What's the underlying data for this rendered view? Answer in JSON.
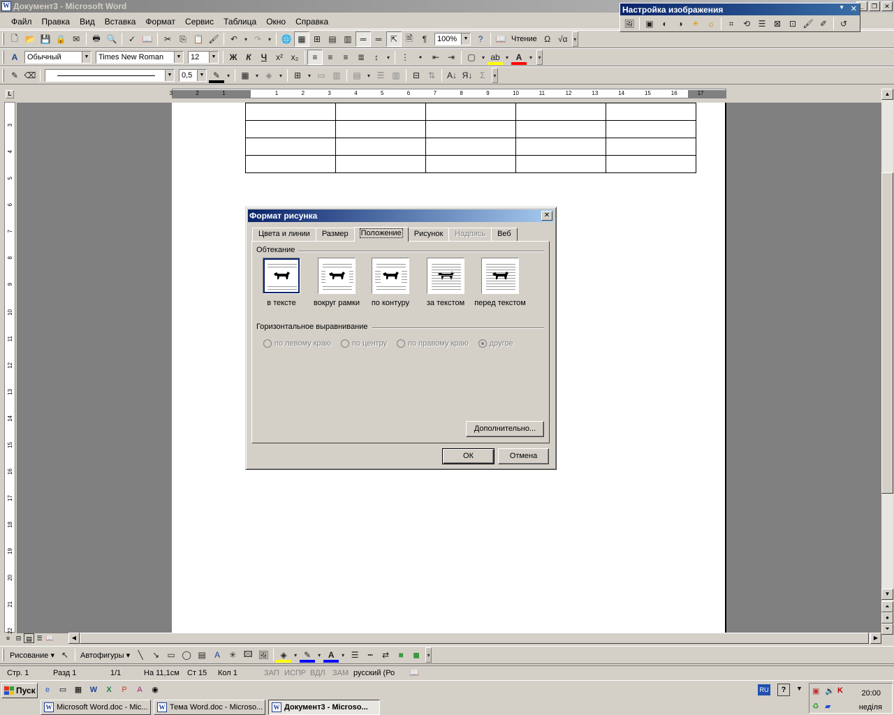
{
  "window": {
    "title": "Документ3 - Microsoft Word",
    "app_icon_letter": "W"
  },
  "menu": [
    "Файл",
    "Правка",
    "Вид",
    "Вставка",
    "Формат",
    "Сервис",
    "Таблица",
    "Окно",
    "Справка"
  ],
  "standard_toolbar": {
    "zoom": "100%",
    "reading_label": "Чтение"
  },
  "formatting_toolbar": {
    "style": "Обычный",
    "font": "Times New Roman",
    "size": "12"
  },
  "tables_toolbar": {
    "line_weight": "0,5"
  },
  "ruler": {
    "h_ticks": [
      "3",
      "2",
      "1",
      "1",
      "2",
      "3",
      "4",
      "5",
      "6",
      "7",
      "8",
      "9",
      "10",
      "11",
      "12",
      "13",
      "14",
      "15",
      "16",
      "17"
    ],
    "v_ticks": [
      "3",
      "4",
      "5",
      "6",
      "7",
      "8",
      "9",
      "10",
      "11",
      "12",
      "13",
      "14",
      "15",
      "16",
      "17",
      "18",
      "19",
      "20",
      "21",
      "22"
    ],
    "corner": "L"
  },
  "picture_toolbar": {
    "title": "Настройка изображения"
  },
  "dialog": {
    "title": "Формат рисунка",
    "tabs": [
      {
        "label": "Цвета и линии",
        "state": "normal"
      },
      {
        "label": "Размер",
        "state": "normal"
      },
      {
        "label": "Положение",
        "state": "selected"
      },
      {
        "label": "Рисунок",
        "state": "normal"
      },
      {
        "label": "Надпись",
        "state": "disabled"
      },
      {
        "label": "Веб",
        "state": "normal"
      }
    ],
    "wrap_group": "Обтекание",
    "wrap_options": [
      {
        "label": "в тексте",
        "selected": true
      },
      {
        "label": "вокруг рамки",
        "selected": false
      },
      {
        "label": "по контуру",
        "selected": false
      },
      {
        "label": "за текстом",
        "selected": false
      },
      {
        "label": "перед текстом",
        "selected": false
      }
    ],
    "halign_group": "Горизонтальное выравнивание",
    "halign_options": [
      {
        "label": "по левому краю",
        "checked": false
      },
      {
        "label": "по центру",
        "checked": false
      },
      {
        "label": "по правому краю",
        "checked": false
      },
      {
        "label": "другое",
        "checked": true
      }
    ],
    "advanced_button": "Дополнительно...",
    "ok_button": "ОК",
    "cancel_button": "Отмена"
  },
  "drawing_toolbar": {
    "draw_label": "Рисование",
    "autoshapes_label": "Автофигуры"
  },
  "status": {
    "page": "Стр. 1",
    "section": "Разд 1",
    "pages": "1/1",
    "at": "На 11,1см",
    "line": "Ст 15",
    "col": "Кол 1",
    "rec": "ЗАП",
    "trk": "ИСПР",
    "ext": "ВДЛ",
    "ovr": "ЗАМ",
    "lang": "русский (Ро"
  },
  "taskbar": {
    "start": "Пуск",
    "tasks": [
      "Microsoft Word.doc - Mic...",
      "Тема Word.doc - Microso...",
      "Документ3 - Microso..."
    ],
    "lang": "RU",
    "clock": "20:00",
    "day": "неділя"
  }
}
